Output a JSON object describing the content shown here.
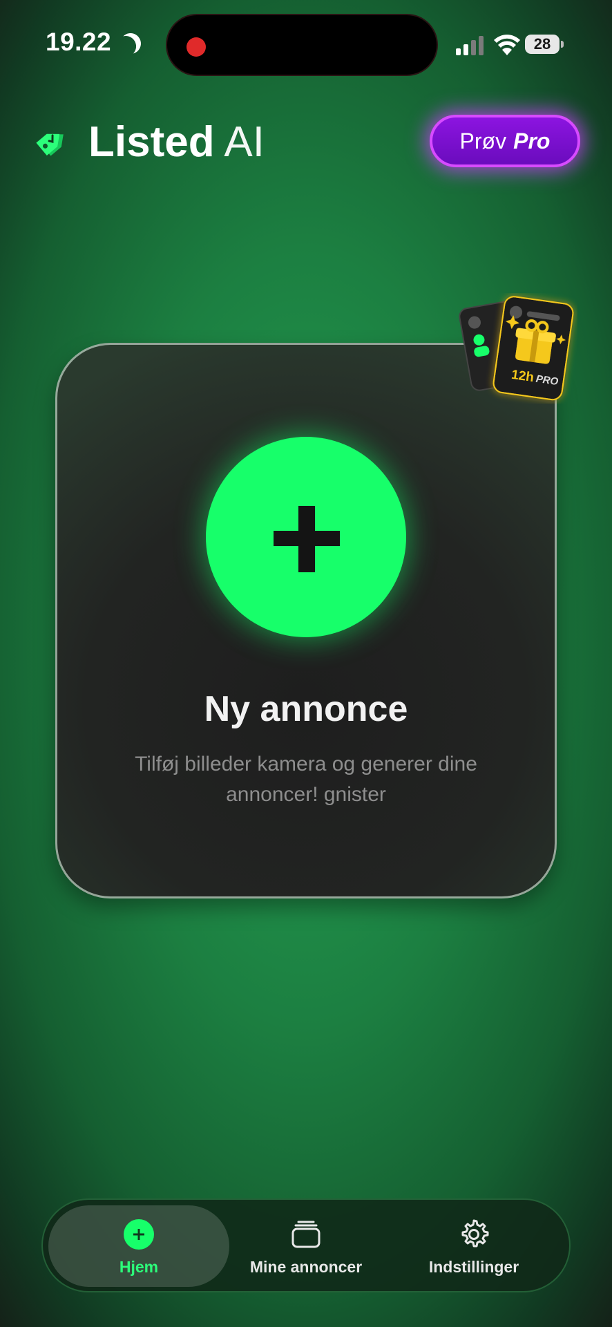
{
  "status_bar": {
    "time": "19.22",
    "battery": "28",
    "icons": [
      "moon-icon",
      "recording-dot",
      "signal-icon",
      "wifi-icon",
      "battery-icon"
    ]
  },
  "header": {
    "logo_icon": "price-tag-icon",
    "app_name_bold": "Listed",
    "app_name_light": "AI",
    "pro_button": {
      "prefix": "Prøv",
      "highlight": "Pro"
    }
  },
  "promo_badge": {
    "icon": "gift-icon",
    "hours": "12h",
    "label": "PRO"
  },
  "main_card": {
    "icon": "plus-icon",
    "title": "Ny annonce",
    "description": "Tilføj billeder kamera og generer dine annoncer! gnister"
  },
  "bottom_nav": {
    "items": [
      {
        "label": "Hjem",
        "icon": "plus-circle-icon",
        "active": true
      },
      {
        "label": "Mine annoncer",
        "icon": "stack-icon",
        "active": false
      },
      {
        "label": "Indstillinger",
        "icon": "gear-icon",
        "active": false
      }
    ]
  },
  "colors": {
    "accent_green": "#17ff6a",
    "pro_purple": "#8c14e0",
    "gold": "#f5c81a"
  }
}
